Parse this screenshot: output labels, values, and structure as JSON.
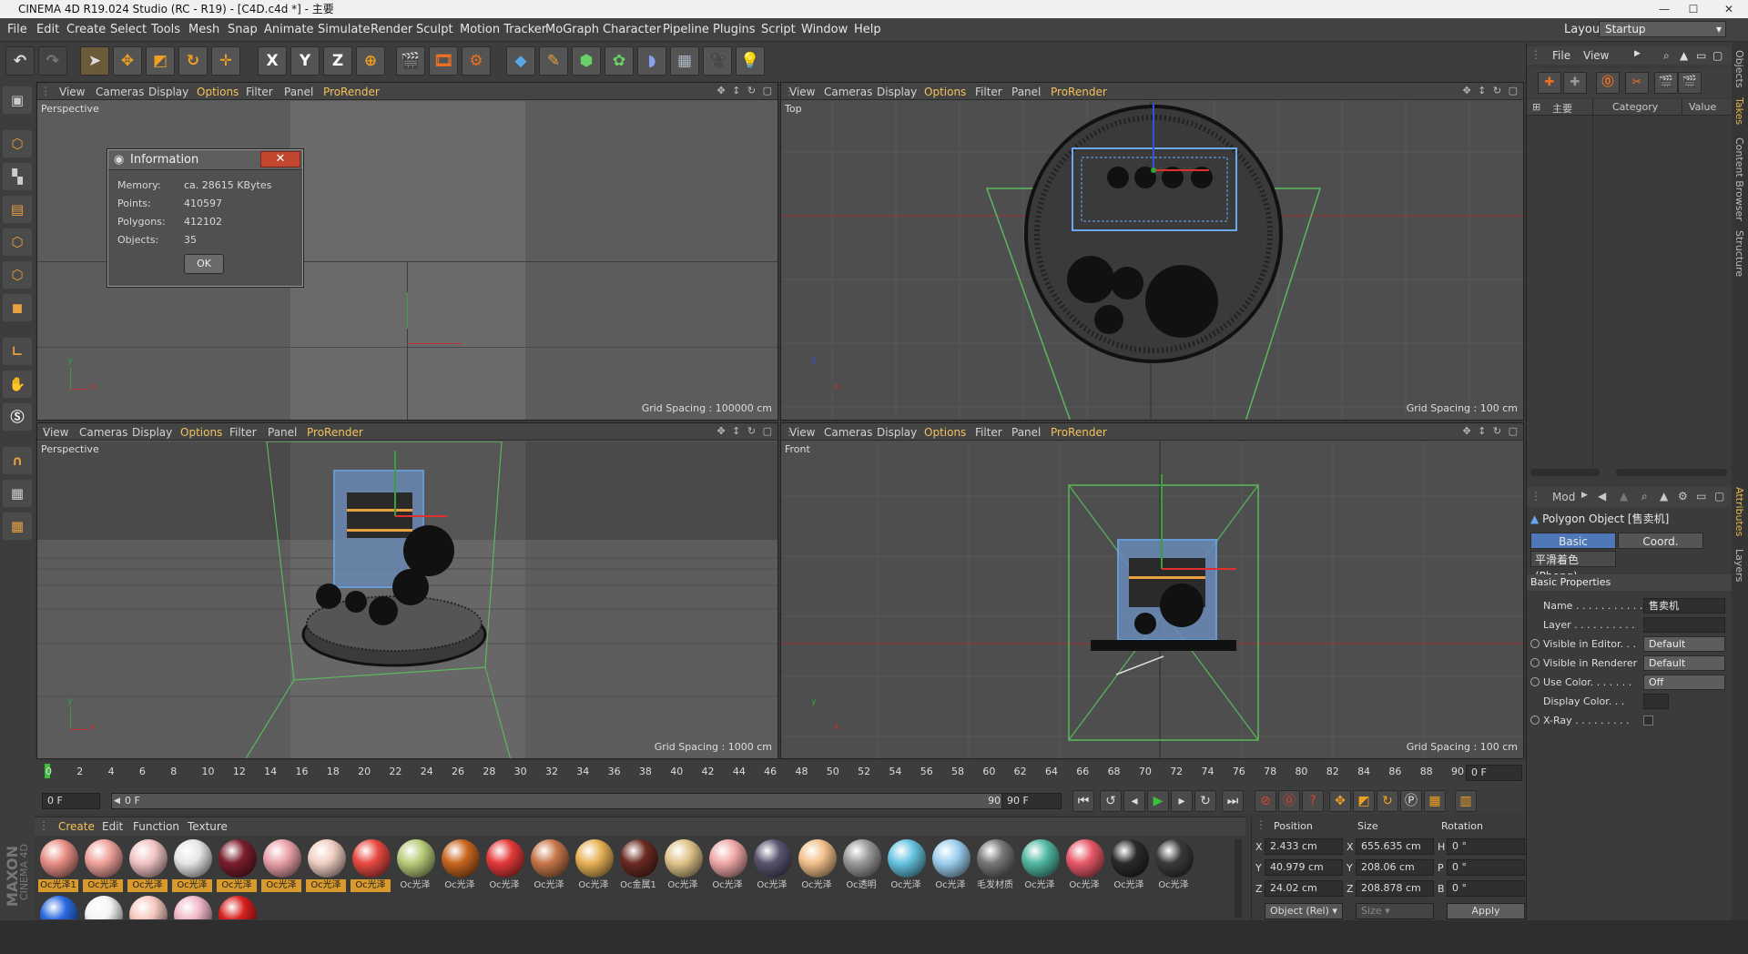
{
  "window": {
    "title": "CINEMA 4D R19.024 Studio (RC - R19) - [C4D.c4d *] - 主要"
  },
  "menu": [
    "File",
    "Edit",
    "Create",
    "Select",
    "Tools",
    "Mesh",
    "Snap",
    "Animate",
    "Simulate",
    "Render",
    "Sculpt",
    "Motion Tracker",
    "MoGraph",
    "Character",
    "Pipeline",
    "Plugins",
    "Script",
    "Window",
    "Help"
  ],
  "layout": {
    "label": "Layout:",
    "value": "Startup"
  },
  "toolbar_icons": [
    "undo-icon",
    "redo-icon",
    "select-arrow-icon",
    "move-icon",
    "scale-icon",
    "rotate-icon",
    "add-object-icon",
    "x-axis-icon",
    "y-axis-icon",
    "z-axis-icon",
    "world-coords-icon",
    "render-view-icon",
    "render-picture-icon",
    "render-settings-icon",
    "cube-icon",
    "pen-icon",
    "subdivision-icon",
    "cloner-icon",
    "deformer-icon",
    "floor-icon",
    "camera-icon",
    "light-icon"
  ],
  "toolbar_glyphs": {
    "x": "X",
    "y": "Y",
    "z": "Z"
  },
  "viewport_menu": {
    "view": "View",
    "cameras": "Cameras",
    "display": "Display",
    "options": "Options",
    "filter": "Filter",
    "panel": "Panel",
    "prorender": "ProRender"
  },
  "viewports": [
    {
      "label": "Perspective",
      "grid": "Grid Spacing : 100000 cm"
    },
    {
      "label": "Top",
      "grid": "Grid Spacing : 100 cm"
    },
    {
      "label": "Perspective",
      "grid": "Grid Spacing : 1000 cm"
    },
    {
      "label": "Front",
      "grid": "Grid Spacing : 100 cm"
    }
  ],
  "axis_labels": {
    "x": "x",
    "y": "y",
    "z": "z"
  },
  "info_dialog": {
    "title": "Information",
    "rows": [
      {
        "label": "Memory:",
        "value": "ca. 28615 KBytes"
      },
      {
        "label": "Points:",
        "value": "410597"
      },
      {
        "label": "Polygons:",
        "value": "412102"
      },
      {
        "label": "Objects:",
        "value": "35"
      }
    ],
    "ok": "OK"
  },
  "timeline": {
    "ticks": [
      "0",
      "2",
      "4",
      "6",
      "8",
      "10",
      "12",
      "14",
      "16",
      "18",
      "20",
      "22",
      "24",
      "26",
      "28",
      "30",
      "32",
      "34",
      "36",
      "38",
      "40",
      "42",
      "44",
      "46",
      "48",
      "50",
      "52",
      "54",
      "56",
      "58",
      "60",
      "62",
      "64",
      "66",
      "68",
      "70",
      "72",
      "74",
      "76",
      "78",
      "80",
      "82",
      "84",
      "86",
      "88",
      "90"
    ],
    "current": "0 F",
    "start": "0 F",
    "range_start": "0 F",
    "range_end": "90 F",
    "end": "90 F"
  },
  "material_menu": [
    "Create",
    "Edit",
    "Function",
    "Texture"
  ],
  "materials": [
    {
      "name": "Oc光泽1",
      "color": "#e88f86",
      "sel": true
    },
    {
      "name": "Oc光泽",
      "color": "#f0a29b",
      "sel": true
    },
    {
      "name": "Oc光泽",
      "color": "#f2c4c4",
      "sel": true
    },
    {
      "name": "Oc光泽",
      "color": "#e6e6e6",
      "sel": true
    },
    {
      "name": "Oc光泽",
      "color": "#7a1e2c",
      "sel": true
    },
    {
      "name": "Oc光泽",
      "color": "#eaa1a8",
      "sel": true
    },
    {
      "name": "Oc光泽",
      "color": "#f0cfc2",
      "sel": true
    },
    {
      "name": "Oc光泽",
      "color": "#e84a42",
      "sel": true
    },
    {
      "name": "Oc光泽",
      "color": "#b8cc7a",
      "sel": false
    },
    {
      "name": "Oc光泽",
      "color": "#c9661e",
      "sel": false
    },
    {
      "name": "Oc光泽",
      "color": "#e33a3a",
      "sel": false
    },
    {
      "name": "Oc光泽",
      "color": "#c8784a",
      "sel": false
    },
    {
      "name": "Oc光泽",
      "color": "#e8b256",
      "sel": false
    },
    {
      "name": "Oc金属1",
      "color": "#6a2a22",
      "sel": false
    },
    {
      "name": "Oc光泽",
      "color": "#e0c48a",
      "sel": false
    },
    {
      "name": "Oc光泽",
      "color": "#f0a8a8",
      "sel": false
    },
    {
      "name": "Oc光泽",
      "color": "#5a5470",
      "sel": false
    },
    {
      "name": "Oc光泽",
      "color": "#f2c08a",
      "sel": false
    },
    {
      "name": "Oc透明",
      "color": "#9a9a9a",
      "sel": false
    },
    {
      "name": "Oc光泽",
      "color": "#66c4e0",
      "sel": false
    },
    {
      "name": "Oc光泽",
      "color": "#9ccff0",
      "sel": false
    },
    {
      "name": "毛发材质",
      "color": "#777777",
      "sel": false
    },
    {
      "name": "Oc光泽",
      "color": "#52b8a2",
      "sel": false
    },
    {
      "name": "Oc光泽",
      "color": "#e85a6a",
      "sel": false
    },
    {
      "name": "Oc光泽",
      "color": "#2a2a2a",
      "sel": false
    },
    {
      "name": "Oc光泽",
      "color": "#3a3a3a",
      "sel": false
    }
  ],
  "materials_row2": [
    {
      "color": "#2a6ae0"
    },
    {
      "color": "#f4f4f4"
    },
    {
      "color": "#f6c8c0"
    },
    {
      "color": "#f0b8c8"
    },
    {
      "color": "#d82020"
    }
  ],
  "coords": {
    "headers": {
      "position": "Position",
      "size": "Size",
      "rotation": "Rotation"
    },
    "rows": [
      {
        "axis": "X",
        "pos": "2.433 cm",
        "saxis": "X",
        "size": "655.635 cm",
        "raxis": "H",
        "rot": "0 °"
      },
      {
        "axis": "Y",
        "pos": "40.979 cm",
        "saxis": "Y",
        "size": "208.06 cm",
        "raxis": "P",
        "rot": "0 °"
      },
      {
        "axis": "Z",
        "pos": "24.02 cm",
        "saxis": "Z",
        "size": "208.878 cm",
        "raxis": "B",
        "rot": "0 °"
      }
    ],
    "mode": "Object (Rel)",
    "size_mode": "Size",
    "apply": "Apply"
  },
  "objects_panel": {
    "menu": [
      "File",
      "View"
    ],
    "root": "主要",
    "columns": {
      "category": "Category",
      "value": "Value"
    }
  },
  "side_tabs": {
    "top": [
      "Objects",
      "Takes",
      "Content Browser",
      "Structure"
    ],
    "bottom": [
      "Attributes",
      "Layers"
    ]
  },
  "attributes": {
    "mode": "Mod",
    "object_title": "Polygon Object [售卖机]",
    "tabs": [
      "Basic",
      "Coord."
    ],
    "phong": "平滑着色(Phong)",
    "section": "Basic Properties",
    "fields": [
      {
        "label": "Name . . . . . . . . . . .",
        "value": "售卖机",
        "kind": "fld2",
        "radio": false
      },
      {
        "label": "Layer  . . . . . . . . . .",
        "value": "",
        "kind": "fld2",
        "radio": false
      },
      {
        "label": "Visible in Editor. . .",
        "value": "Default",
        "kind": "btn",
        "radio": true
      },
      {
        "label": "Visible in Renderer",
        "value": "Default",
        "kind": "btn",
        "radio": true
      },
      {
        "label": "Use Color. . . . . . .",
        "value": "Off",
        "kind": "btn",
        "radio": true
      },
      {
        "label": "Display Color. . .",
        "value": "",
        "kind": "fld2",
        "radio": false
      },
      {
        "label": "X-Ray . . . . . . . . .",
        "value": "",
        "kind": "check",
        "radio": true
      }
    ]
  },
  "brand": {
    "maxon": "MAXON",
    "product": "CINEMA 4D"
  }
}
